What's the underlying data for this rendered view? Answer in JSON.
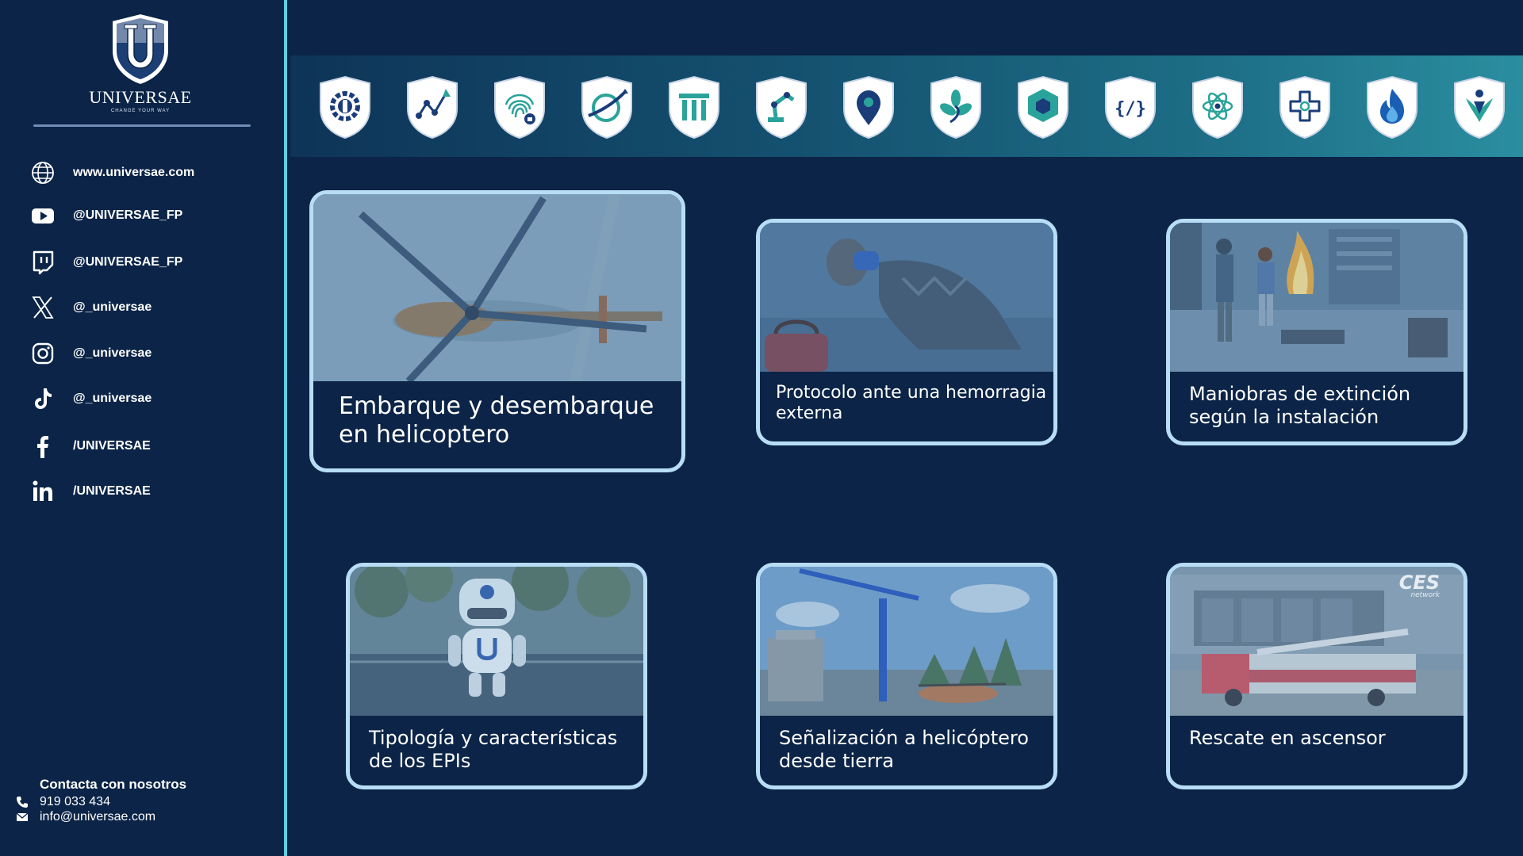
{
  "brand": {
    "name": "UNIVERSAE",
    "tagline": "CHANGE YOUR WAY",
    "logo_letter": "U"
  },
  "social": [
    {
      "icon": "globe-icon",
      "label": "www.universae.com"
    },
    {
      "icon": "youtube-icon",
      "label": "@UNIVERSAE_FP"
    },
    {
      "icon": "twitch-icon",
      "label": "@UNIVERSAE_FP"
    },
    {
      "icon": "x-icon",
      "label": "@_universae"
    },
    {
      "icon": "instagram-icon",
      "label": "@_universae"
    },
    {
      "icon": "tiktok-icon",
      "label": "@_universae"
    },
    {
      "icon": "facebook-icon",
      "label": "/UNIVERSAE"
    },
    {
      "icon": "linkedin-icon",
      "label": "/UNIVERSAE"
    }
  ],
  "contact": {
    "title": "Contacta con nosotros",
    "phone": "919 033 434",
    "email": "info@universae.com"
  },
  "category_icons": [
    "gear-wrench-icon",
    "network-growth-icon",
    "fingerprint-lock-icon",
    "globe-plane-icon",
    "columns-icon",
    "robot-arm-icon",
    "map-pin-icon",
    "leaf-spiral-icon",
    "cube-icon",
    "code-brackets-icon",
    "atom-icon",
    "medical-cross-icon",
    "flame-icon",
    "people-icon"
  ],
  "cards": [
    {
      "title_l1": "Embarque y desembarque",
      "title_l2": "en helicoptero",
      "scene": "helicopter-top-view"
    },
    {
      "title_l1": "Protocolo ante una hemorragia",
      "title_l2": "externa",
      "scene": "injured-person"
    },
    {
      "title_l1": "Maniobras de extinción",
      "title_l2": "según la instalación",
      "scene": "office-fire"
    },
    {
      "title_l1": "Tipología y características",
      "title_l2": "de los EPIs",
      "scene": "robot-mascot"
    },
    {
      "title_l1": "Señalización a helicóptero",
      "title_l2": "desde tierra",
      "scene": "crane-helipad"
    },
    {
      "title_l1": "Rescate en ascensor",
      "title_l2": "",
      "scene": "fire-truck",
      "overlay_text_1": "CES",
      "overlay_text_2": "network"
    }
  ],
  "colors": {
    "background": "#0b2447",
    "accent": "#5fd0e0",
    "card_border": "#b8ddf6",
    "shield_blue": "#1a3d7a",
    "shield_teal": "#2aa39a"
  }
}
